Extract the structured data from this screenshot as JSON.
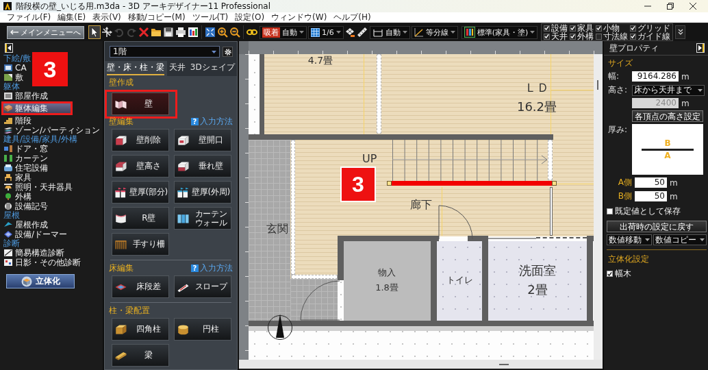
{
  "window": {
    "title": "階段横の壁_いじる用.m3da - 3D アーキデザイナー11 Professional"
  },
  "menu": [
    "ファイル(F)",
    "編集(E)",
    "表示(V)",
    "移動/コピー(M)",
    "ツール(T)",
    "設定(O)",
    "ウィンドウ(W)",
    "ヘルプ(H)"
  ],
  "toolbar": {
    "main_menu": "メインメニューへ",
    "tools": [
      {
        "selected": true,
        "disabled": false
      },
      {
        "selected": false,
        "disabled": false
      },
      {
        "selected": false,
        "disabled": true
      },
      {
        "selected": false,
        "disabled": true
      },
      {
        "selected": false,
        "disabled": false
      },
      {
        "selected": false,
        "disabled": false
      },
      {
        "selected": false,
        "disabled": false
      },
      {
        "selected": false,
        "disabled": false
      },
      {
        "selected": false,
        "disabled": false
      },
      {
        "selected": false,
        "disabled": false
      },
      {
        "selected": false,
        "disabled": false
      },
      {
        "selected": false,
        "disabled": false
      },
      {
        "selected": false,
        "disabled": false
      }
    ],
    "snap": {
      "tag": "吸着",
      "value": "自動"
    },
    "scale": "1/6",
    "dimension": "自動",
    "guide": "等分線",
    "display": "標準(家具・塗)",
    "visibility": [
      {
        "label": "設備",
        "checked": true
      },
      {
        "label": "家具",
        "checked": true
      },
      {
        "label": "小物",
        "checked": true
      },
      {
        "label": "グリッド",
        "checked": true
      },
      {
        "label": "天井",
        "checked": true
      },
      {
        "label": "外構",
        "checked": true
      },
      {
        "label": "寸法線",
        "checked": false
      },
      {
        "label": "ガイド線",
        "checked": true
      }
    ]
  },
  "sidebar": {
    "sections": [
      {
        "heading": "下絵/敷",
        "items": [
          {
            "label": "CA",
            "selected": false,
            "annotated": false
          },
          {
            "label": "敷",
            "selected": false,
            "annotated": false
          }
        ]
      },
      {
        "heading": "躯体",
        "items": [
          {
            "label": "部屋作成",
            "selected": false,
            "annotated": false
          },
          {
            "label": "躯体編集",
            "selected": true,
            "annotated": true
          },
          {
            "label": "階段",
            "selected": false,
            "annotated": false
          },
          {
            "label": "ゾーン/パーティション",
            "selected": false,
            "annotated": false
          }
        ]
      },
      {
        "heading": "建具/設備/家具/外構",
        "items": [
          {
            "label": "ドア・窓",
            "selected": false,
            "annotated": false
          },
          {
            "label": "カーテン",
            "selected": false,
            "annotated": false
          },
          {
            "label": "住宅設備",
            "selected": false,
            "annotated": false
          },
          {
            "label": "家具",
            "selected": false,
            "annotated": false
          },
          {
            "label": "照明・天井器具",
            "selected": false,
            "annotated": false
          },
          {
            "label": "外構",
            "selected": false,
            "annotated": false
          },
          {
            "label": "設備記号",
            "selected": false,
            "annotated": false
          }
        ]
      },
      {
        "heading": "屋根",
        "items": [
          {
            "label": "屋根作成",
            "selected": false,
            "annotated": false
          },
          {
            "label": "設備/ドーマー",
            "selected": false,
            "annotated": false
          }
        ]
      },
      {
        "heading": "診断",
        "items": [
          {
            "label": "簡易構造診断",
            "selected": false,
            "annotated": false
          },
          {
            "label": "日影・その他診断",
            "selected": false,
            "annotated": false
          }
        ]
      }
    ],
    "render_button": "立体化",
    "badge": "3"
  },
  "palette": {
    "floor": "1階",
    "tabs": [
      {
        "label": "壁・床・柱・梁",
        "selected": true
      },
      {
        "label": "天井",
        "selected": false
      },
      {
        "label": "3Dシェイプ",
        "selected": false
      }
    ],
    "sections": [
      {
        "heading": "壁作成",
        "buttons": [
          {
            "label": "壁",
            "selected": true,
            "annotated": true
          }
        ]
      },
      {
        "heading": "壁編集",
        "help": {
          "mark": "?",
          "label": "入力方法"
        },
        "buttons": [
          {
            "label": "壁削除",
            "selected": false,
            "annotated": false
          },
          {
            "label": "壁開口",
            "selected": false,
            "annotated": false
          },
          {
            "label": "壁高さ",
            "selected": false,
            "annotated": false
          },
          {
            "label": "垂れ壁",
            "selected": false,
            "annotated": false
          },
          {
            "label": "壁厚(部分)",
            "selected": false,
            "annotated": false
          },
          {
            "label": "壁厚(外周)",
            "selected": false,
            "annotated": false
          },
          {
            "label": "R壁",
            "selected": false,
            "annotated": false
          },
          {
            "label": "カーテンウォール",
            "selected": false,
            "annotated": false
          },
          {
            "label": "手すり柵",
            "selected": false,
            "annotated": false
          }
        ]
      },
      {
        "heading": "床編集",
        "help": {
          "mark": "?",
          "label": "入力方法"
        },
        "buttons": [
          {
            "label": "床段差",
            "selected": false,
            "annotated": false
          },
          {
            "label": "スロープ",
            "selected": false,
            "annotated": false
          }
        ]
      },
      {
        "heading": "柱・梁配置",
        "buttons": [
          {
            "label": "四角柱",
            "selected": false,
            "annotated": false
          },
          {
            "label": "円柱",
            "selected": false,
            "annotated": false
          },
          {
            "label": "梁",
            "selected": false,
            "annotated": false
          }
        ]
      }
    ]
  },
  "plan": {
    "rooms": [
      {
        "area": "4.7畳"
      },
      {
        "name": "ＬＤ",
        "area": "16.2畳"
      },
      {
        "name": "廊下"
      },
      {
        "name": "玄関"
      },
      {
        "name": "物入",
        "area": "1.8畳"
      },
      {
        "name": "トイレ"
      },
      {
        "name": "洗面室",
        "area": "2畳"
      }
    ],
    "stairs_label": "UP",
    "stair_wall": {
      "selected": true
    },
    "badge": "3"
  },
  "properties": {
    "title": "壁プロパティ",
    "size_heading": "サイズ",
    "width": {
      "label": "幅:",
      "value": "9164.286",
      "unit": "m"
    },
    "height": {
      "label": "高さ:",
      "value": "床から天井まで"
    },
    "height_value": {
      "value": "2400",
      "unit": "m",
      "disabled": true
    },
    "vertex_button": "各頂点の高さ設定",
    "thickness": {
      "label": "厚み:",
      "side_b": "B",
      "side_a": "A"
    },
    "a_side": {
      "label": "A側",
      "value": "50",
      "unit": "m"
    },
    "b_side": {
      "label": "B側",
      "value": "50",
      "unit": "m"
    },
    "save_default": {
      "label": "既定値として保存",
      "checked": false
    },
    "reset_button": "出荷時の設定に戻す",
    "dropdowns": [
      "数値移動",
      "数値コピー"
    ],
    "render_heading": "立体化設定",
    "baseboard": {
      "label": "幅木",
      "checked": true
    }
  }
}
